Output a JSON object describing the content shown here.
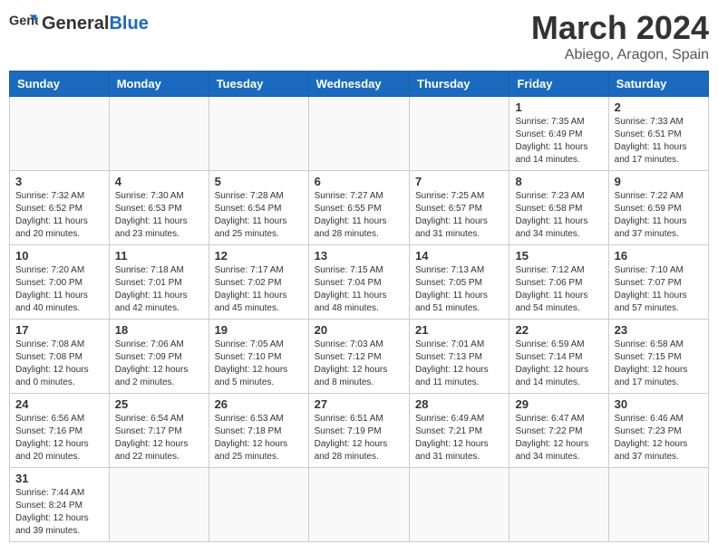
{
  "header": {
    "logo_general": "General",
    "logo_blue": "Blue",
    "month": "March 2024",
    "location": "Abiego, Aragon, Spain"
  },
  "days_of_week": [
    "Sunday",
    "Monday",
    "Tuesday",
    "Wednesday",
    "Thursday",
    "Friday",
    "Saturday"
  ],
  "weeks": [
    [
      {
        "day": "",
        "info": ""
      },
      {
        "day": "",
        "info": ""
      },
      {
        "day": "",
        "info": ""
      },
      {
        "day": "",
        "info": ""
      },
      {
        "day": "",
        "info": ""
      },
      {
        "day": "1",
        "info": "Sunrise: 7:35 AM\nSunset: 6:49 PM\nDaylight: 11 hours and 14 minutes."
      },
      {
        "day": "2",
        "info": "Sunrise: 7:33 AM\nSunset: 6:51 PM\nDaylight: 11 hours and 17 minutes."
      }
    ],
    [
      {
        "day": "3",
        "info": "Sunrise: 7:32 AM\nSunset: 6:52 PM\nDaylight: 11 hours and 20 minutes."
      },
      {
        "day": "4",
        "info": "Sunrise: 7:30 AM\nSunset: 6:53 PM\nDaylight: 11 hours and 23 minutes."
      },
      {
        "day": "5",
        "info": "Sunrise: 7:28 AM\nSunset: 6:54 PM\nDaylight: 11 hours and 25 minutes."
      },
      {
        "day": "6",
        "info": "Sunrise: 7:27 AM\nSunset: 6:55 PM\nDaylight: 11 hours and 28 minutes."
      },
      {
        "day": "7",
        "info": "Sunrise: 7:25 AM\nSunset: 6:57 PM\nDaylight: 11 hours and 31 minutes."
      },
      {
        "day": "8",
        "info": "Sunrise: 7:23 AM\nSunset: 6:58 PM\nDaylight: 11 hours and 34 minutes."
      },
      {
        "day": "9",
        "info": "Sunrise: 7:22 AM\nSunset: 6:59 PM\nDaylight: 11 hours and 37 minutes."
      }
    ],
    [
      {
        "day": "10",
        "info": "Sunrise: 7:20 AM\nSunset: 7:00 PM\nDaylight: 11 hours and 40 minutes."
      },
      {
        "day": "11",
        "info": "Sunrise: 7:18 AM\nSunset: 7:01 PM\nDaylight: 11 hours and 42 minutes."
      },
      {
        "day": "12",
        "info": "Sunrise: 7:17 AM\nSunset: 7:02 PM\nDaylight: 11 hours and 45 minutes."
      },
      {
        "day": "13",
        "info": "Sunrise: 7:15 AM\nSunset: 7:04 PM\nDaylight: 11 hours and 48 minutes."
      },
      {
        "day": "14",
        "info": "Sunrise: 7:13 AM\nSunset: 7:05 PM\nDaylight: 11 hours and 51 minutes."
      },
      {
        "day": "15",
        "info": "Sunrise: 7:12 AM\nSunset: 7:06 PM\nDaylight: 11 hours and 54 minutes."
      },
      {
        "day": "16",
        "info": "Sunrise: 7:10 AM\nSunset: 7:07 PM\nDaylight: 11 hours and 57 minutes."
      }
    ],
    [
      {
        "day": "17",
        "info": "Sunrise: 7:08 AM\nSunset: 7:08 PM\nDaylight: 12 hours and 0 minutes."
      },
      {
        "day": "18",
        "info": "Sunrise: 7:06 AM\nSunset: 7:09 PM\nDaylight: 12 hours and 2 minutes."
      },
      {
        "day": "19",
        "info": "Sunrise: 7:05 AM\nSunset: 7:10 PM\nDaylight: 12 hours and 5 minutes."
      },
      {
        "day": "20",
        "info": "Sunrise: 7:03 AM\nSunset: 7:12 PM\nDaylight: 12 hours and 8 minutes."
      },
      {
        "day": "21",
        "info": "Sunrise: 7:01 AM\nSunset: 7:13 PM\nDaylight: 12 hours and 11 minutes."
      },
      {
        "day": "22",
        "info": "Sunrise: 6:59 AM\nSunset: 7:14 PM\nDaylight: 12 hours and 14 minutes."
      },
      {
        "day": "23",
        "info": "Sunrise: 6:58 AM\nSunset: 7:15 PM\nDaylight: 12 hours and 17 minutes."
      }
    ],
    [
      {
        "day": "24",
        "info": "Sunrise: 6:56 AM\nSunset: 7:16 PM\nDaylight: 12 hours and 20 minutes."
      },
      {
        "day": "25",
        "info": "Sunrise: 6:54 AM\nSunset: 7:17 PM\nDaylight: 12 hours and 22 minutes."
      },
      {
        "day": "26",
        "info": "Sunrise: 6:53 AM\nSunset: 7:18 PM\nDaylight: 12 hours and 25 minutes."
      },
      {
        "day": "27",
        "info": "Sunrise: 6:51 AM\nSunset: 7:19 PM\nDaylight: 12 hours and 28 minutes."
      },
      {
        "day": "28",
        "info": "Sunrise: 6:49 AM\nSunset: 7:21 PM\nDaylight: 12 hours and 31 minutes."
      },
      {
        "day": "29",
        "info": "Sunrise: 6:47 AM\nSunset: 7:22 PM\nDaylight: 12 hours and 34 minutes."
      },
      {
        "day": "30",
        "info": "Sunrise: 6:46 AM\nSunset: 7:23 PM\nDaylight: 12 hours and 37 minutes."
      }
    ],
    [
      {
        "day": "31",
        "info": "Sunrise: 7:44 AM\nSunset: 8:24 PM\nDaylight: 12 hours and 39 minutes."
      },
      {
        "day": "",
        "info": ""
      },
      {
        "day": "",
        "info": ""
      },
      {
        "day": "",
        "info": ""
      },
      {
        "day": "",
        "info": ""
      },
      {
        "day": "",
        "info": ""
      },
      {
        "day": "",
        "info": ""
      }
    ]
  ]
}
